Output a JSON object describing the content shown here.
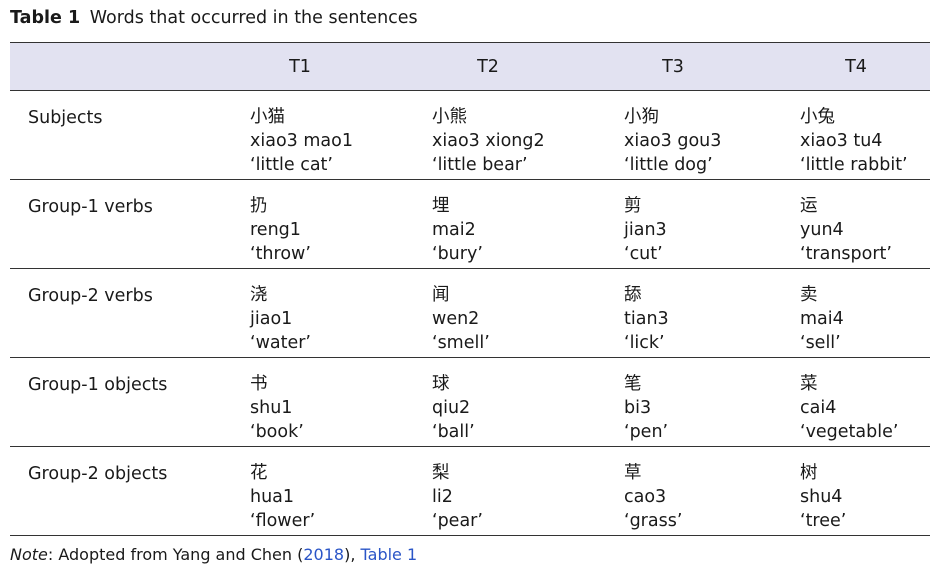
{
  "caption": {
    "label": "Table 1",
    "text": "Words that occurred in the sentences"
  },
  "header": [
    "T1",
    "T2",
    "T3",
    "T4"
  ],
  "rows": [
    {
      "label": "Subjects",
      "cells": [
        {
          "hanzi": "小猫",
          "pinyin": "xiao3 mao1",
          "gloss": "‘little cat’"
        },
        {
          "hanzi": "小熊",
          "pinyin": "xiao3 xiong2",
          "gloss": "‘little bear’"
        },
        {
          "hanzi": "小狗",
          "pinyin": "xiao3 gou3",
          "gloss": "‘little dog’"
        },
        {
          "hanzi": "小兔",
          "pinyin": "xiao3 tu4",
          "gloss": "‘little rabbit’"
        }
      ]
    },
    {
      "label": "Group-1 verbs",
      "cells": [
        {
          "hanzi": "扔",
          "pinyin": "reng1",
          "gloss": "‘throw’"
        },
        {
          "hanzi": "埋",
          "pinyin": "mai2",
          "gloss": "‘bury’"
        },
        {
          "hanzi": "剪",
          "pinyin": "jian3",
          "gloss": "‘cut’"
        },
        {
          "hanzi": "运",
          "pinyin": "yun4",
          "gloss": "‘transport’"
        }
      ]
    },
    {
      "label": "Group-2 verbs",
      "cells": [
        {
          "hanzi": "浇",
          "pinyin": "jiao1",
          "gloss": "‘water’"
        },
        {
          "hanzi": "闻",
          "pinyin": "wen2",
          "gloss": "‘smell’"
        },
        {
          "hanzi": "舔",
          "pinyin": "tian3",
          "gloss": "‘lick’"
        },
        {
          "hanzi": "卖",
          "pinyin": "mai4",
          "gloss": "‘sell’"
        }
      ]
    },
    {
      "label": "Group-1 objects",
      "cells": [
        {
          "hanzi": "书",
          "pinyin": "shu1",
          "gloss": "‘book’"
        },
        {
          "hanzi": "球",
          "pinyin": "qiu2",
          "gloss": "‘ball’"
        },
        {
          "hanzi": "笔",
          "pinyin": "bi3",
          "gloss": "‘pen’"
        },
        {
          "hanzi": "菜",
          "pinyin": "cai4",
          "gloss": "‘vegetable’"
        }
      ]
    },
    {
      "label": "Group-2 objects",
      "cells": [
        {
          "hanzi": "花",
          "pinyin": "hua1",
          "gloss": "‘flower’"
        },
        {
          "hanzi": "梨",
          "pinyin": "li2",
          "gloss": "‘pear’"
        },
        {
          "hanzi": "草",
          "pinyin": "cao3",
          "gloss": "‘grass’"
        },
        {
          "hanzi": "树",
          "pinyin": "shu4",
          "gloss": "‘tree’"
        }
      ]
    }
  ],
  "note": {
    "label": "Note",
    "text": ": Adopted from Yang and Chen (",
    "year_link": "2018",
    "mid": "), ",
    "table_link": "Table 1"
  },
  "colors": {
    "header_bg": "#e2e2f1",
    "link": "#2a55c7",
    "rule": "#333333"
  }
}
